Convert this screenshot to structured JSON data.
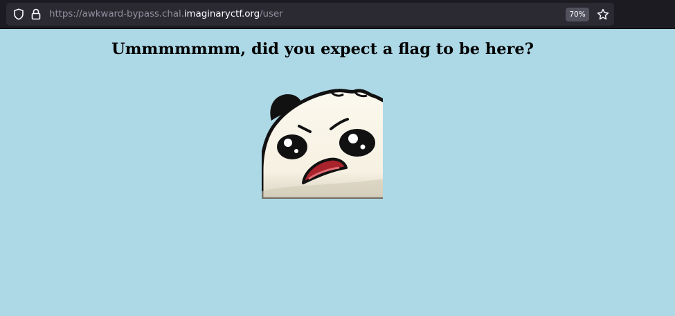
{
  "browser": {
    "url_scheme": "https://",
    "url_subdomain": "awkward-bypass.chal.",
    "url_host": "imaginaryctf.org",
    "url_path": "/user",
    "zoom": "70%",
    "icons": [
      "shield-icon",
      "lock-icon",
      "star-icon"
    ]
  },
  "page": {
    "heading": "Ummmmmmm, did you expect a flag to be here?",
    "image": "panda-emote-image",
    "background_color": "#add8e6"
  }
}
